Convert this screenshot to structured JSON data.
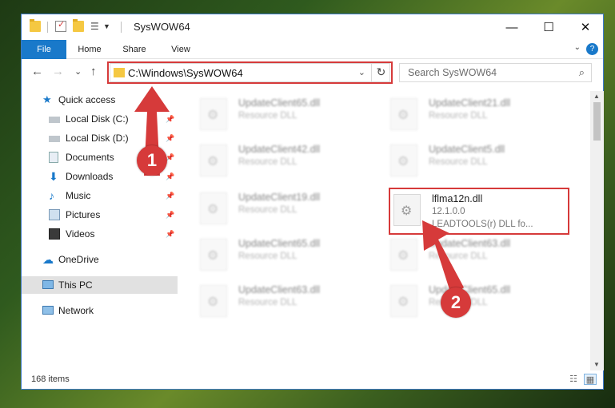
{
  "window": {
    "title": "SysWOW64"
  },
  "ribbon": {
    "tabs": [
      "File",
      "Home",
      "Share",
      "View"
    ],
    "help": "?"
  },
  "nav": {
    "back": "←",
    "forward": "→",
    "recent": "⌄",
    "up": "↑"
  },
  "address": {
    "path": "C:\\Windows\\SysWOW64",
    "dropdown": "⌄",
    "refresh": "↻"
  },
  "search": {
    "placeholder": "Search SysWOW64"
  },
  "sidebar": {
    "items": [
      {
        "label": "Quick access"
      },
      {
        "label": "Local Disk (C:)"
      },
      {
        "label": "Local Disk (D:)"
      },
      {
        "label": "Documents"
      },
      {
        "label": "Downloads"
      },
      {
        "label": "Music"
      },
      {
        "label": "Pictures"
      },
      {
        "label": "Videos"
      },
      {
        "label": "OneDrive"
      },
      {
        "label": "This PC"
      },
      {
        "label": "Network"
      }
    ]
  },
  "files": [
    {
      "name": "UpdateClient65.dll",
      "line2": "Resource DLL"
    },
    {
      "name": "UpdateClient21.dll",
      "line2": "Resource DLL"
    },
    {
      "name": "UpdateClient42.dll",
      "line2": "Resource DLL"
    },
    {
      "name": "UpdateClient5.dll",
      "line2": "Resource DLL"
    },
    {
      "name": "UpdateClient19.dll",
      "line2": "Resource DLL"
    },
    {
      "name": "lflma12n.dll",
      "line2": "12.1.0.0",
      "line3": "LEADTOOLS(r) DLL fo..."
    },
    {
      "name": "UpdateClient65.dll",
      "line2": "Resource DLL"
    },
    {
      "name": "UpdateClient63.dll",
      "line2": "Resource DLL"
    },
    {
      "name": "UpdateClient63.dll",
      "line2": "Resource DLL"
    },
    {
      "name": "UpdateClient65.dll",
      "line2": "Resource DLL"
    }
  ],
  "status": {
    "count": "168 items"
  },
  "callouts": {
    "one": "1",
    "two": "2"
  },
  "colors": {
    "accent": "#1979ca",
    "highlight": "#d63a3a"
  },
  "icons": {
    "folder": "folder-icon",
    "pin": "pin-icon",
    "search": "search-icon",
    "dll": "dll-gear-icon",
    "refresh": "refresh-icon"
  }
}
